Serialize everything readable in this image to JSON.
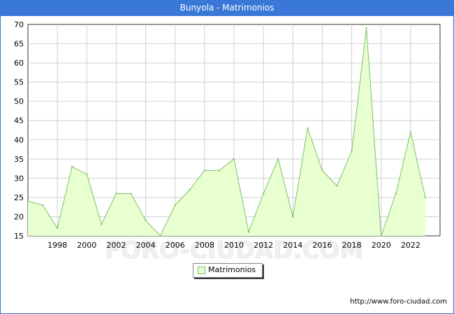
{
  "title": "Bunyola - Matrimonios",
  "source_text": "http://www.foro-ciudad.com",
  "watermark_text": "FORO-CIUDAD.COM",
  "colors": {
    "header": "#3a78d8",
    "series_fill": "#e8ffd0",
    "series_line": "#7cc16a",
    "grid": "#d0d0d0"
  },
  "chart_data": {
    "type": "area",
    "title": "Bunyola - Matrimonios",
    "xlabel": "",
    "ylabel": "",
    "x": [
      1996,
      1997,
      1998,
      1999,
      2000,
      2001,
      2002,
      2003,
      2004,
      2005,
      2006,
      2007,
      2008,
      2009,
      2010,
      2011,
      2012,
      2013,
      2014,
      2015,
      2016,
      2017,
      2018,
      2019,
      2020,
      2021,
      2022,
      2023
    ],
    "series": [
      {
        "name": "Matrimonios",
        "values": [
          24,
          23,
          17,
          33,
          31,
          18,
          26,
          26,
          19,
          15,
          23,
          27,
          32,
          32,
          35,
          16,
          26,
          35,
          20,
          43,
          32,
          28,
          37,
          69,
          15,
          26,
          42,
          25
        ]
      }
    ],
    "x_ticks": [
      "1998",
      "2000",
      "2002",
      "2004",
      "2006",
      "2008",
      "2010",
      "2012",
      "2014",
      "2016",
      "2018",
      "2020",
      "2022"
    ],
    "y_ticks": [
      "15",
      "20",
      "25",
      "30",
      "35",
      "40",
      "45",
      "50",
      "55",
      "60",
      "65",
      "70"
    ],
    "xlim": [
      1996,
      2024
    ],
    "ylim": [
      15,
      70
    ],
    "grid": true,
    "legend_position": "bottom-center"
  }
}
